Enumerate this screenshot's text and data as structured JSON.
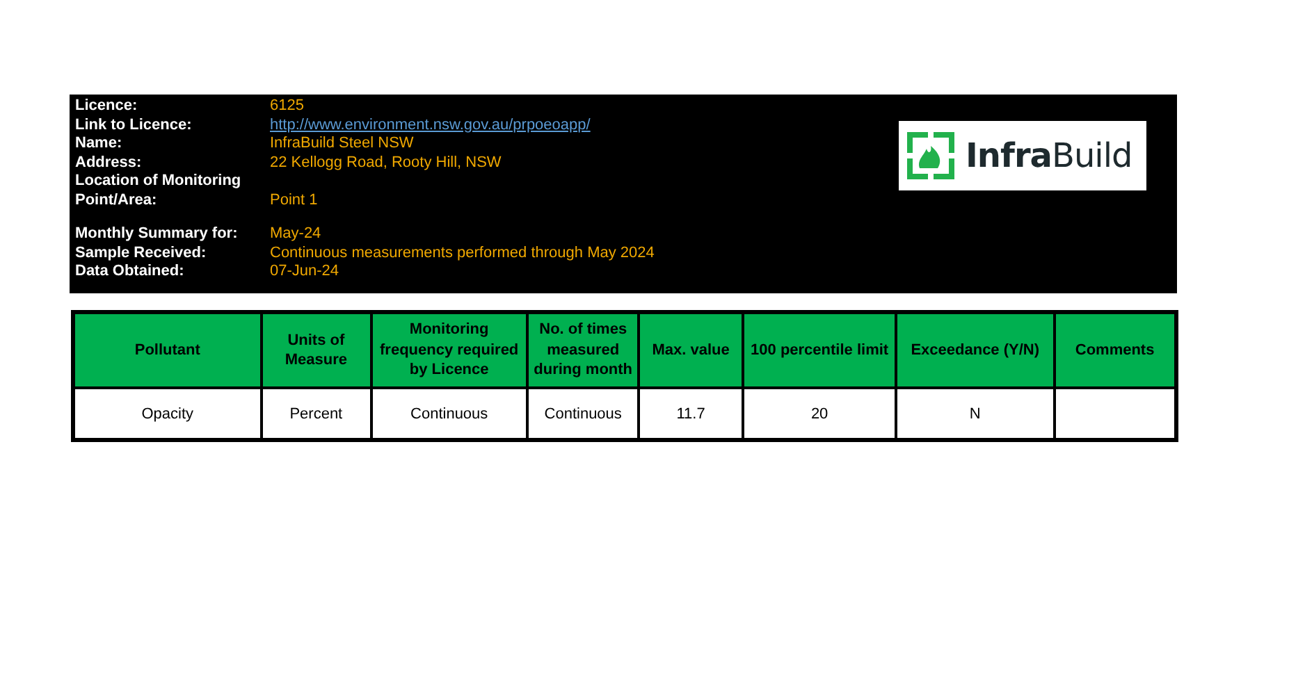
{
  "info_groups": [
    [
      {
        "label": "Licence:",
        "value": "6125",
        "kind": "text"
      },
      {
        "label": "Link to Licence:",
        "value": "http://www.environment.nsw.gov.au/prpoeoapp/",
        "kind": "link"
      },
      {
        "label": "Name:",
        "value": "InfraBuild Steel NSW",
        "kind": "text"
      },
      {
        "label": "Address:",
        "value": "22 Kellogg Road, Rooty Hill, NSW",
        "kind": "text"
      },
      {
        "label": "Location of Monitoring"
      },
      {
        "label": "Point/Area:",
        "value": "Point 1",
        "kind": "text"
      }
    ],
    [
      {
        "label": "Monthly Summary for:",
        "value": "May-24",
        "kind": "text"
      },
      {
        "label": "Sample Received:",
        "value": "Continuous measurements performed through May 2024",
        "kind": "text"
      },
      {
        "label": "Data Obtained:",
        "value": "07-Jun-24",
        "kind": "text"
      }
    ]
  ],
  "logo": {
    "text": "**Infra**Build"
  },
  "table": {
    "columns": [
      "Pollutant",
      "Units of Measure",
      "Monitoring frequency required by Licence",
      "No. of times measured during month",
      "Max. value",
      "100 percentile limit",
      "Exceedance (Y/N)",
      "Comments"
    ],
    "rows": [
      [
        "Opacity",
        "Percent",
        "Continuous",
        "Continuous",
        "11.7",
        "20",
        "N",
        ""
      ]
    ]
  }
}
